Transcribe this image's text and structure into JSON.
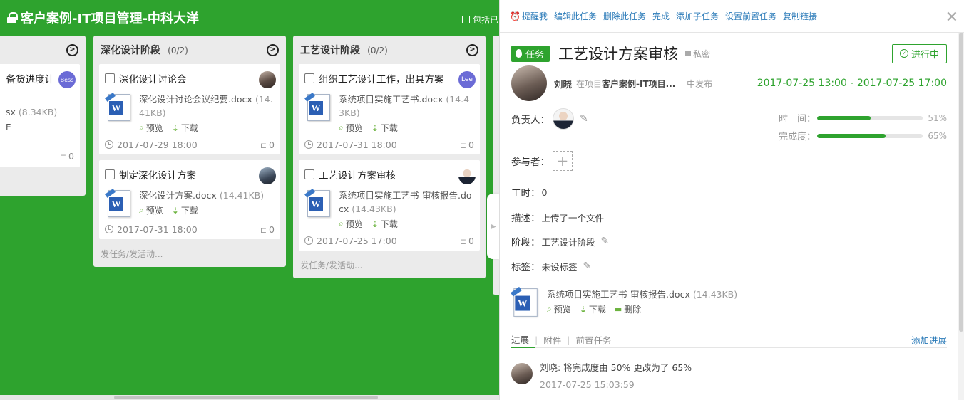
{
  "project": {
    "title": "客户案例-IT项目管理-中科大洋",
    "include_done_label": "包括已"
  },
  "partial_column": {
    "title_fragment": "备货进度计",
    "avatar": "Bess",
    "file_fragment": "sx",
    "file_size": "(8.34KB)",
    "extra_fragment": "E",
    "subtasks": "0"
  },
  "columns": [
    {
      "title": "深化设计阶段",
      "count": "(0/2)",
      "add_task_label": "发任务/发活动...",
      "cards": [
        {
          "title": "深化设计讨论会",
          "file_name": "深化设计讨论会议纪要.docx",
          "file_size": "(14.41KB)",
          "preview": "预览",
          "download": "下载",
          "date": "2017-07-29 18:00",
          "subtasks": "0"
        },
        {
          "title": "制定深化设计方案",
          "file_name": "深化设计方案.docx",
          "file_size": "(14.41KB)",
          "preview": "预览",
          "download": "下载",
          "date": "2017-07-31 18:00",
          "subtasks": "0"
        }
      ]
    },
    {
      "title": "工艺设计阶段",
      "count": "(0/2)",
      "add_task_label": "发任务/发活动...",
      "cards": [
        {
          "title": "组织工艺设计工作，出具方案",
          "avatar": "Lee",
          "file_name": "系统项目实施工艺书.docx",
          "file_size": "(14.43KB)",
          "preview": "预览",
          "download": "下载",
          "date": "2017-07-31 18:00",
          "subtasks": "0"
        },
        {
          "title": "工艺设计方案审核",
          "file_name": "系统项目实施工艺书-审核报告.docx",
          "file_size": "(14.43KB)",
          "preview": "预览",
          "download": "下载",
          "date": "2017-07-25 17:00",
          "subtasks": "0"
        }
      ]
    }
  ],
  "toolbar": {
    "remind": "提醒我",
    "edit": "编辑此任务",
    "delete": "删除此任务",
    "complete": "完成",
    "add_subtask": "添加子任务",
    "set_prereq": "设置前置任务",
    "copy_link": "复制链接"
  },
  "task": {
    "badge": "任务",
    "title": "工艺设计方案审核",
    "privacy": "私密",
    "status": "进行中",
    "author": "刘晓",
    "in_project": "在项目",
    "project_short": "客户案例-IT项目...",
    "published": "中发布",
    "date_range": "2017-07-25 13:00 - 2017-07-25 17:00",
    "owner_label": "负责人：",
    "participants_label": "参与者：",
    "hours_label": "工时：",
    "hours_value": "0",
    "desc_label": "描述：",
    "desc_value": "上传了一个文件",
    "stage_label": "阶段：",
    "stage_value": "工艺设计阶段",
    "tags_label": "标签：",
    "tags_value": "未设标签",
    "time_label": "时　间：",
    "time_pct": "51%",
    "time_value": 51,
    "progress_label": "完成度：",
    "progress_pct": "65%",
    "progress_value": 65,
    "attachment": {
      "name": "系统项目实施工艺书-审核报告.docx",
      "size": "(14.43KB)",
      "preview": "预览",
      "download": "下载",
      "delete": "删除"
    },
    "tabs": [
      "进展",
      "附件",
      "前置任务"
    ],
    "add_progress": "添加进展",
    "activity": {
      "text": "刘晓: 将完成度由 50% 更改为了 65%",
      "time": "2017-07-25 15:03:59"
    }
  },
  "colors": {
    "brand_green": "#2ea32e",
    "link_blue": "#2a7ab8"
  }
}
